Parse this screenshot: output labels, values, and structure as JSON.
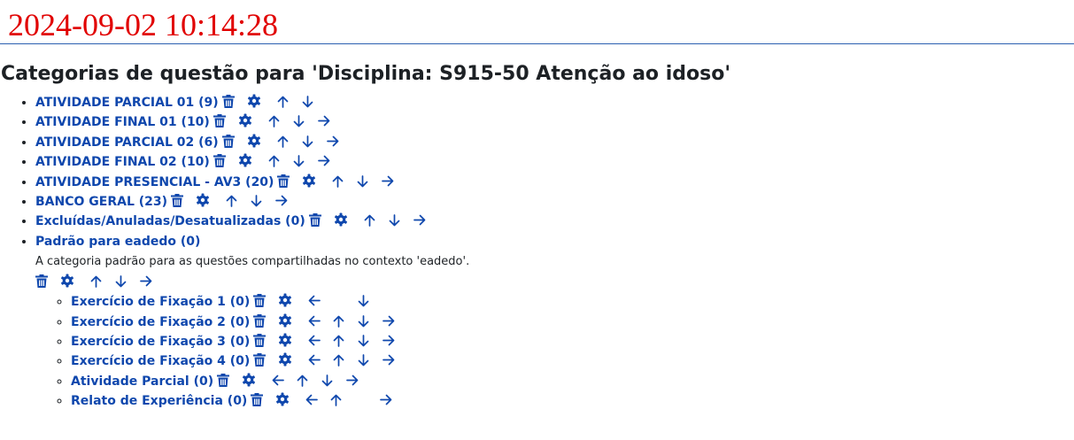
{
  "header": {
    "timestamp": "2024-09-02 10:14:28"
  },
  "page": {
    "title": "Categorias de questão para 'Disciplina: S915-50 Atenção ao idoso'"
  },
  "icons": {
    "delete": "trash-icon",
    "edit": "gear-icon",
    "left": "arrow-left-icon",
    "up": "arrow-up-icon",
    "down": "arrow-down-icon",
    "right": "arrow-right-icon"
  },
  "categories": [
    {
      "label": "ATIVIDADE PARCIAL 01 (9)",
      "moves": [
        "up",
        "down"
      ]
    },
    {
      "label": "ATIVIDADE FINAL 01 (10)",
      "moves": [
        "up",
        "down",
        "right"
      ]
    },
    {
      "label": "ATIVIDADE PARCIAL 02 (6)",
      "moves": [
        "up",
        "down",
        "right"
      ]
    },
    {
      "label": "ATIVIDADE FINAL 02 (10)",
      "moves": [
        "up",
        "down",
        "right"
      ]
    },
    {
      "label": "ATIVIDADE PRESENCIAL - AV3 (20)",
      "moves": [
        "up",
        "down",
        "right"
      ]
    },
    {
      "label": "BANCO GERAL (23)",
      "moves": [
        "up",
        "down",
        "right"
      ]
    },
    {
      "label": "Excluídas/Anuladas/Desatualizadas (0)",
      "moves": [
        "up",
        "down",
        "right"
      ]
    }
  ],
  "default_category": {
    "label": "Padrão para eadedo (0)",
    "description": "A categoria padrão para as questões compartilhadas no contexto 'eadedo'.",
    "moves": [
      "up",
      "down",
      "right"
    ],
    "children": [
      {
        "label": "Exercício de Fixação 1 (0)",
        "moves": [
          "left",
          "blank",
          "down"
        ]
      },
      {
        "label": "Exercício de Fixação 2 (0)",
        "moves": [
          "left",
          "up",
          "down",
          "right"
        ]
      },
      {
        "label": "Exercício de Fixação 3 (0)",
        "moves": [
          "left",
          "up",
          "down",
          "right"
        ]
      },
      {
        "label": "Exercício de Fixação 4 (0)",
        "moves": [
          "left",
          "up",
          "down",
          "right"
        ]
      },
      {
        "label": "Atividade Parcial (0)",
        "moves": [
          "left",
          "up",
          "down",
          "right"
        ]
      },
      {
        "label": "Relato de Experiência (0)",
        "moves": [
          "left",
          "up",
          "blank",
          "right"
        ]
      }
    ]
  }
}
